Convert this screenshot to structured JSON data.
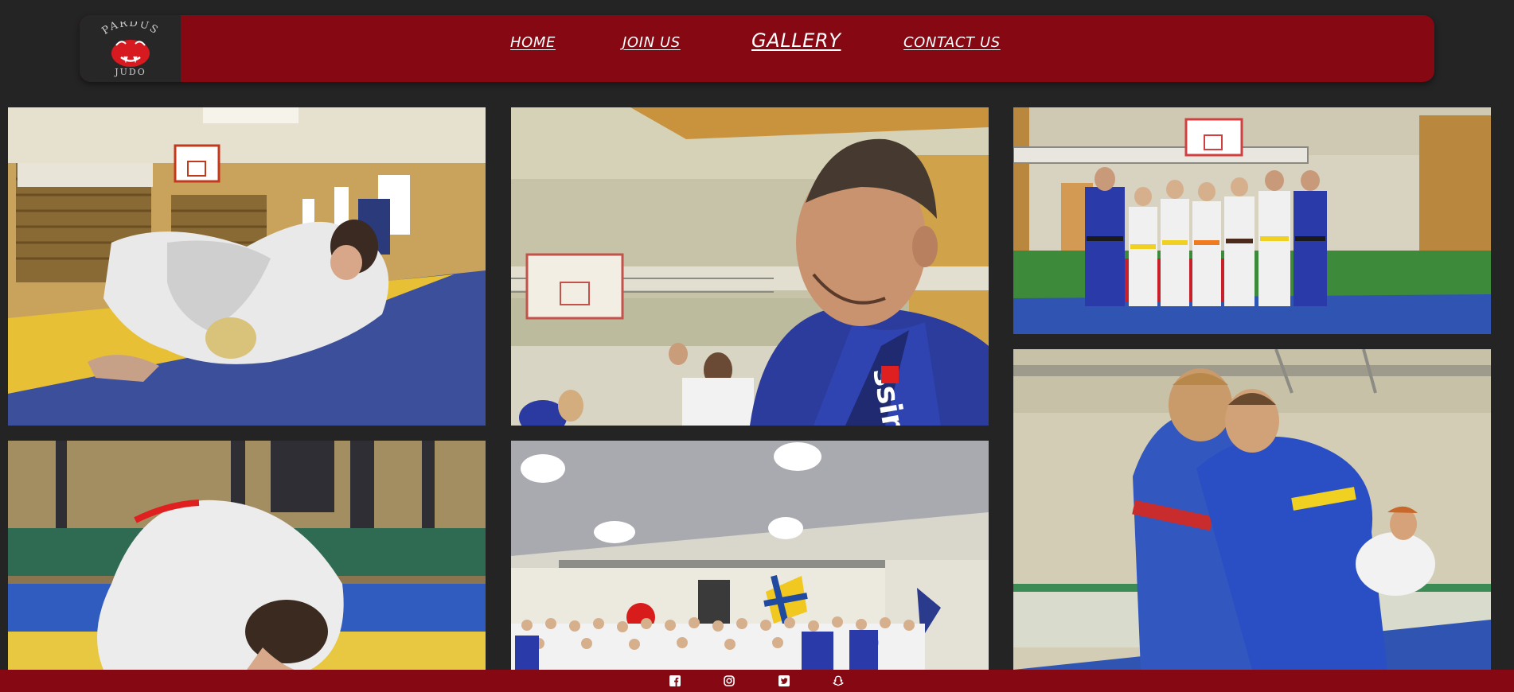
{
  "brand": {
    "logo_text_top": "PARDUS",
    "logo_text_bottom": "JUDO",
    "primary_color": "#860812",
    "background_color": "#242424"
  },
  "nav": {
    "items": [
      {
        "label": "HOME",
        "active": false
      },
      {
        "label": "JOIN US",
        "active": false
      },
      {
        "label": "GALLERY",
        "active": true
      },
      {
        "label": "CONTACT US",
        "active": false
      }
    ]
  },
  "gallery": {
    "photos": [
      {
        "subject": "judo-groundwork-photo"
      },
      {
        "subject": "judo-coach-portrait-photo"
      },
      {
        "subject": "judo-group-photo"
      },
      {
        "subject": "judo-throw-photo"
      },
      {
        "subject": "judo-club-assembly-photo"
      },
      {
        "subject": "judo-standing-grip-photo"
      }
    ]
  },
  "footer": {
    "social_icons": [
      "facebook-icon",
      "instagram-icon",
      "twitter-icon",
      "snapchat-icon"
    ]
  }
}
